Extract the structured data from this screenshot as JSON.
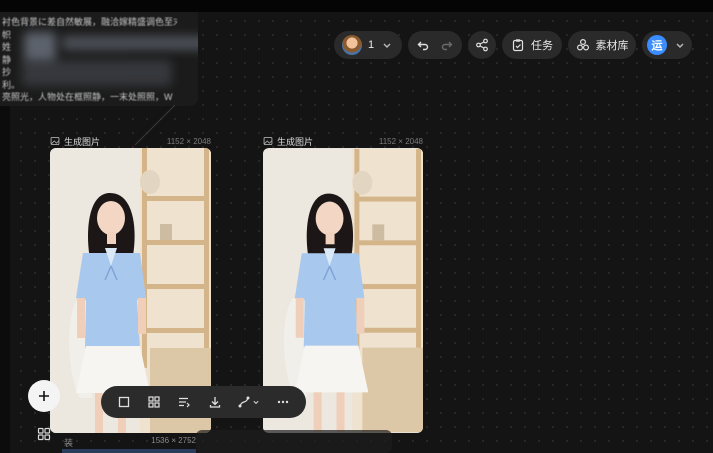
{
  "prompt_panel": {
    "text_lines": [
      "衬色背景に差自然敏展，融洽嫁精盛调色至末",
      "帜",
      "姓",
      "静",
      "抄",
      "利。",
      "亮照光，人物处在框照静，一末处照照，W"
    ]
  },
  "toolbar": {
    "member_count": "1",
    "tasks_label": "任务",
    "library_label": "素材库",
    "app_avatar_char": "运"
  },
  "cards": [
    {
      "name": "生成图片",
      "dims": "1152 × 2048"
    },
    {
      "name": "生成图片",
      "dims": "1152 × 2048"
    }
  ],
  "bottom_card": {
    "name": "装",
    "dims": "1536 × 2752"
  },
  "colors": {
    "canvas_bg": "#141414",
    "pill_bg": "#2a2a2a",
    "accent_blue": "#3b8cff",
    "shirt_blue": "#a9c8ee"
  }
}
